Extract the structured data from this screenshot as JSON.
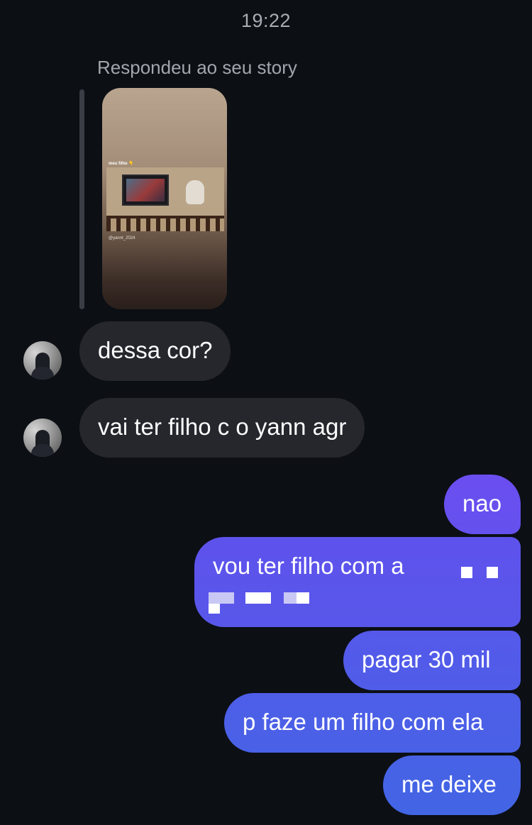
{
  "header": {
    "time": "19:22"
  },
  "story_reply": {
    "label": "Respondeu ao seu story",
    "story_caption": "meu filho 👇",
    "story_handle": "@yannt_2024"
  },
  "messages": [
    {
      "direction": "incoming",
      "text": "dessa cor?"
    },
    {
      "direction": "incoming",
      "text": "vai ter filho c o yann agr"
    },
    {
      "direction": "outgoing",
      "text": "nao"
    },
    {
      "direction": "outgoing",
      "text": "vou ter filho com a"
    },
    {
      "direction": "outgoing",
      "text": "pagar 30 mil"
    },
    {
      "direction": "outgoing",
      "text": "p faze um filho com ela"
    },
    {
      "direction": "outgoing",
      "text": "me deixe"
    }
  ],
  "colors": {
    "background": "#0c0f14",
    "incoming_bubble": "#25272d",
    "outgoing_gradient_top": "#6a4ff0",
    "outgoing_gradient_bottom": "#3f5fe6",
    "timestamp": "#a9acb3"
  }
}
